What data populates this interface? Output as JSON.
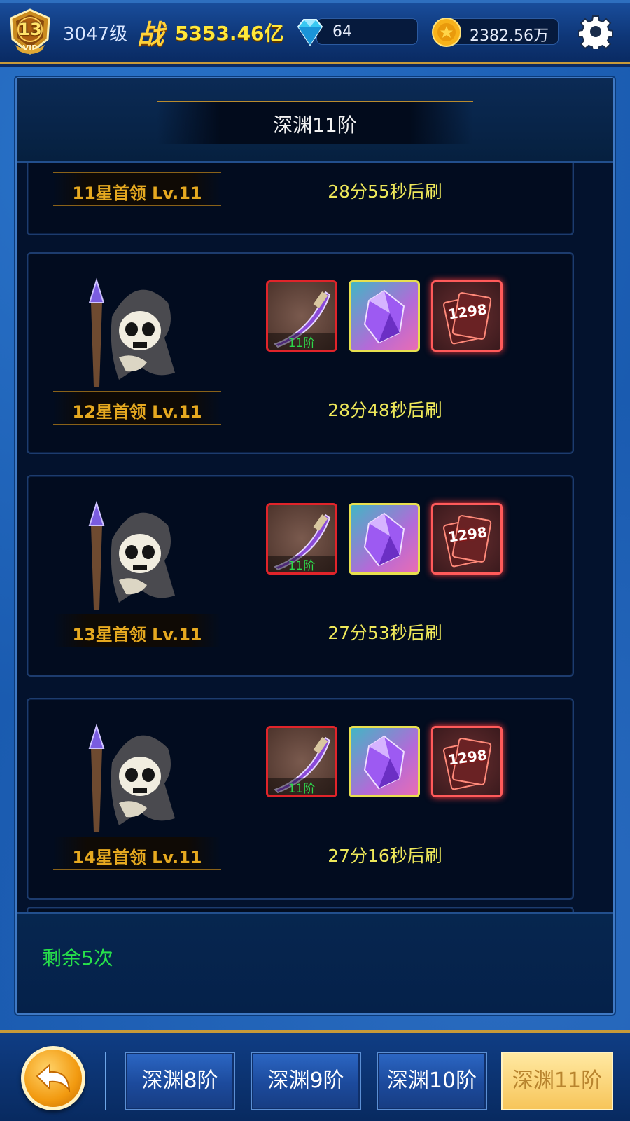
{
  "topbar": {
    "vip_level": "13",
    "vip_label": "VIP",
    "player_level": "3047级",
    "power_glyph": "战",
    "power_value": "5353.46亿",
    "gems": "64",
    "gold": "2382.56万"
  },
  "panel": {
    "title": "深渊11阶",
    "remaining_label": "剩余5次"
  },
  "bosses": [
    {
      "name": "11星首领 Lv.11",
      "refresh": "28分55秒后刷"
    },
    {
      "name": "12星首领 Lv.11",
      "refresh": "28分48秒后刷",
      "rewards": [
        {
          "icon": "purple-blade-icon",
          "tag": "11阶"
        },
        {
          "icon": "purple-crystal-icon"
        },
        {
          "icon": "card-bundle-icon",
          "count": "1298"
        }
      ]
    },
    {
      "name": "13星首领 Lv.11",
      "refresh": "27分53秒后刷",
      "rewards": [
        {
          "icon": "purple-blade-icon",
          "tag": "11阶"
        },
        {
          "icon": "purple-crystal-icon"
        },
        {
          "icon": "card-bundle-icon",
          "count": "1298"
        }
      ]
    },
    {
      "name": "14星首领 Lv.11",
      "refresh": "27分16秒后刷",
      "rewards": [
        {
          "icon": "purple-blade-icon",
          "tag": "11阶"
        },
        {
          "icon": "purple-crystal-icon"
        },
        {
          "icon": "card-bundle-icon",
          "count": "1298"
        }
      ]
    }
  ],
  "tabs": [
    {
      "label": "深渊8阶",
      "active": false
    },
    {
      "label": "深渊9阶",
      "active": false
    },
    {
      "label": "深渊10阶",
      "active": false
    },
    {
      "label": "深渊11阶",
      "active": true
    }
  ],
  "colors": {
    "accent_gold": "#c79a3a",
    "boss_name": "#e6a920",
    "refresh_text": "#eee85a",
    "remaining_text": "#27e04a",
    "tier_tag": "#2dd84a",
    "active_tab": "#f7c55a"
  }
}
